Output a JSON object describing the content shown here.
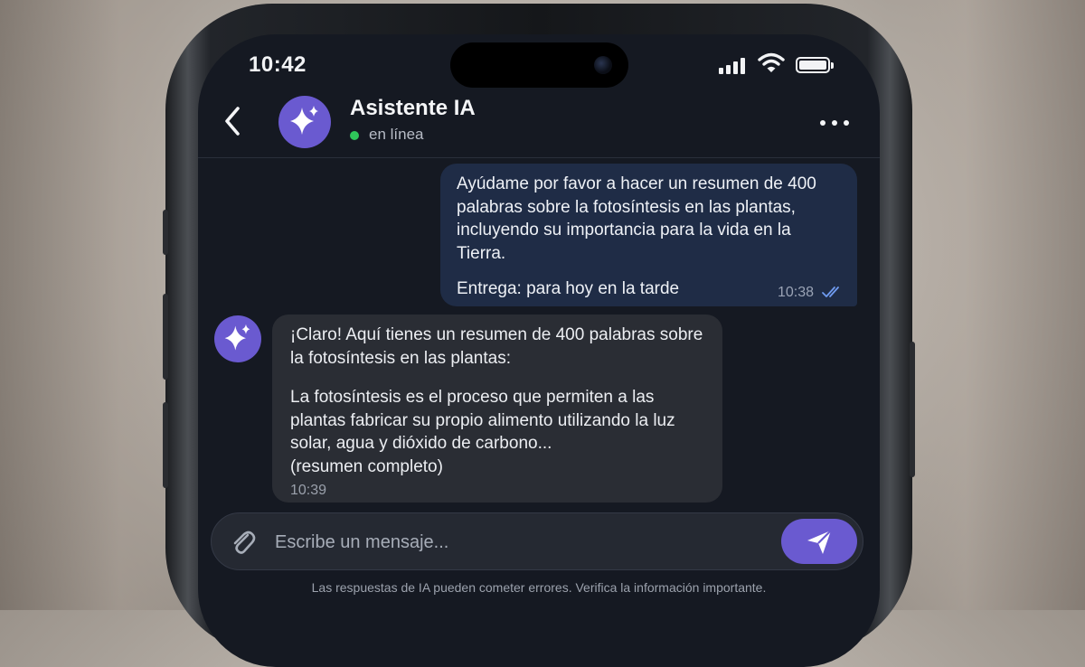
{
  "status_bar": {
    "time": "10:42"
  },
  "header": {
    "title": "Asistente IA",
    "status": "en línea",
    "avatar_icon": "sparkle-icon",
    "accent_color": "#6a5ad0"
  },
  "messages": {
    "user": {
      "text": "Ayúdame por favor a hacer un resumen de 400 palabras sobre la fotosíntesis en las plantas, incluyendo su importancia para la vida en la Tierra.",
      "delivery": "Entrega: para hoy en la tarde",
      "time": "10:38",
      "status_icon": "double-check-icon"
    },
    "bot": {
      "intro": "¡Claro! Aquí tienes un resumen de 400 palabras sobre la fotosíntesis en las plantas:",
      "body": "La fotosíntesis es el proceso que permiten a las plantas fabricar su propio alimento utilizando la luz solar, agua y dióxido de carbono...",
      "note": "(resumen completo)",
      "time": "10:39"
    }
  },
  "composer": {
    "placeholder": "Escribe un mensaje...",
    "attach_icon": "paperclip-icon",
    "send_icon": "send-icon"
  },
  "disclaimer": "Las respuestas de IA pueden cometer errores. Verifica la información importante."
}
